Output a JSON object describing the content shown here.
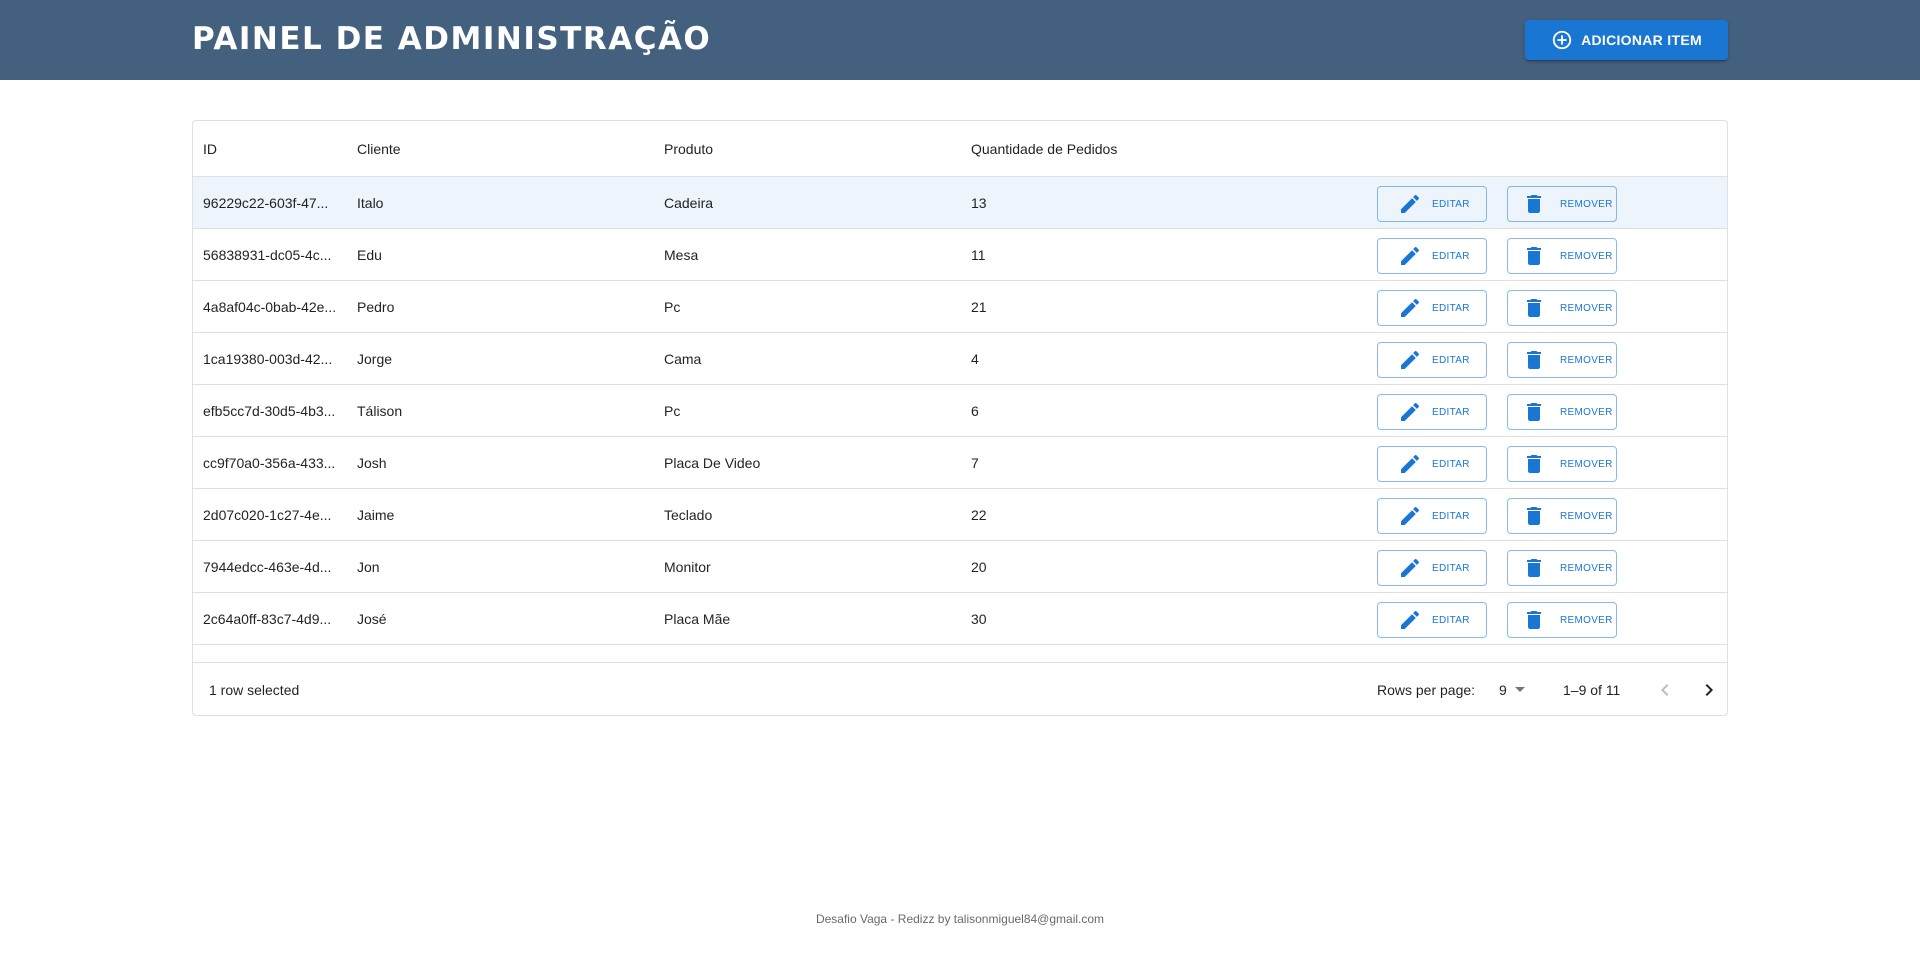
{
  "header": {
    "title": "PAINEL DE ADMINISTRAÇÃO",
    "add_button_label": "ADICIONAR ITEM"
  },
  "table": {
    "columns": [
      "ID",
      "Cliente",
      "Produto",
      "Quantidade de Pedidos"
    ],
    "rows": [
      {
        "id": "96229c22-603f-47...",
        "cliente": "Italo",
        "produto": "Cadeira",
        "quantidade": "13",
        "selected": true
      },
      {
        "id": "56838931-dc05-4c...",
        "cliente": "Edu",
        "produto": "Mesa",
        "quantidade": "11",
        "selected": false
      },
      {
        "id": "4a8af04c-0bab-42e...",
        "cliente": "Pedro",
        "produto": "Pc",
        "quantidade": "21",
        "selected": false
      },
      {
        "id": "1ca19380-003d-42...",
        "cliente": "Jorge",
        "produto": "Cama",
        "quantidade": "4",
        "selected": false
      },
      {
        "id": "efb5cc7d-30d5-4b3...",
        "cliente": "Tálison",
        "produto": "Pc",
        "quantidade": "6",
        "selected": false
      },
      {
        "id": "cc9f70a0-356a-433...",
        "cliente": "Josh",
        "produto": "Placa De Video",
        "quantidade": "7",
        "selected": false
      },
      {
        "id": "2d07c020-1c27-4e...",
        "cliente": "Jaime",
        "produto": "Teclado",
        "quantidade": "22",
        "selected": false
      },
      {
        "id": "7944edcc-463e-4d...",
        "cliente": "Jon",
        "produto": "Monitor",
        "quantidade": "20",
        "selected": false
      },
      {
        "id": "2c64a0ff-83c7-4d9...",
        "cliente": "José",
        "produto": "Placa Mãe",
        "quantidade": "30",
        "selected": false
      }
    ],
    "edit_label": "EDITAR",
    "remove_label": "REMOVER"
  },
  "pagination": {
    "selected_text": "1 row selected",
    "rows_per_page_label": "Rows per page:",
    "rows_per_page_value": "9",
    "range_text": "1–9 of 11"
  },
  "footer": {
    "text": "Desafio Vaga - Redizz by talisonmiguel84@gmail.com"
  },
  "icons": {
    "add": "add-circle-outline-icon",
    "edit": "pencil-icon",
    "remove": "trash-icon",
    "prev": "chevron-left-icon",
    "next": "chevron-right-icon",
    "dropdown": "caret-down-icon"
  },
  "colors": {
    "header_bg": "#44607f",
    "primary": "#1976d2",
    "selected_row": "#edf4fc"
  }
}
